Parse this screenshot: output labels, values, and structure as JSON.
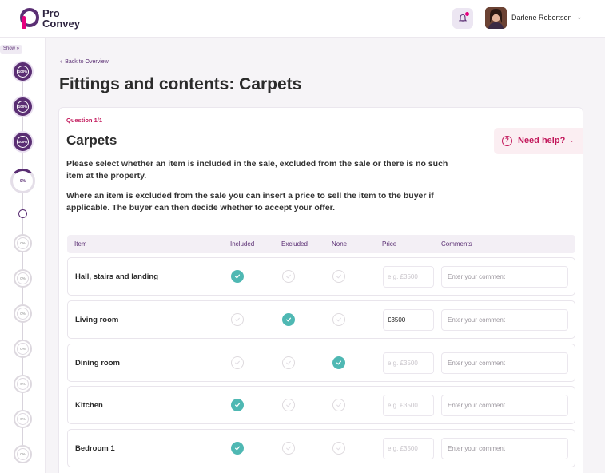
{
  "header": {
    "logo_line1": "Pro",
    "logo_line2": "Convey",
    "user_name": "Darlene Robertson",
    "brand_color": "#5a2e73",
    "accent_color": "#e6007e"
  },
  "rail": {
    "show_label": "Show »",
    "steps": [
      {
        "state": "done",
        "label": "100%"
      },
      {
        "state": "done",
        "label": "100%"
      },
      {
        "state": "done",
        "label": "100%"
      },
      {
        "state": "current",
        "label": "0%"
      },
      {
        "state": "sub",
        "label": ""
      },
      {
        "state": "todo",
        "label": "0%"
      },
      {
        "state": "todo",
        "label": "0%"
      },
      {
        "state": "todo",
        "label": "0%"
      },
      {
        "state": "todo",
        "label": "0%"
      },
      {
        "state": "todo",
        "label": "0%"
      },
      {
        "state": "todo",
        "label": "0%"
      },
      {
        "state": "todo",
        "label": "0%"
      }
    ]
  },
  "main": {
    "back_label": "Back to Overview",
    "page_title": "Fittings and contents: Carpets",
    "question_label": "Question 1/1",
    "question_title": "Carpets",
    "help_label": "Need help?",
    "description_1": "Please select whether an item is included in the sale, excluded from the sale or there is no such item at the property.",
    "description_2": "Where an item is excluded from the sale you can insert a price to sell the item to the buyer if applicable. The buyer can then decide whether to accept your offer."
  },
  "table": {
    "columns": {
      "item": "Item",
      "included": "Included",
      "excluded": "Excluded",
      "none": "None",
      "price": "Price",
      "comments": "Comments"
    },
    "price_placeholder": "e.g. £3500",
    "comment_placeholder": "Enter your comment",
    "check_color": "#4fb8b3",
    "rows": [
      {
        "label": "Hall, stairs and landing",
        "selected": "included",
        "price": ""
      },
      {
        "label": "Living room",
        "selected": "excluded",
        "price": "£3500"
      },
      {
        "label": "Dining room",
        "selected": "none",
        "price": ""
      },
      {
        "label": "Kitchen",
        "selected": "included",
        "price": ""
      },
      {
        "label": "Bedroom 1",
        "selected": "included",
        "price": ""
      }
    ]
  }
}
